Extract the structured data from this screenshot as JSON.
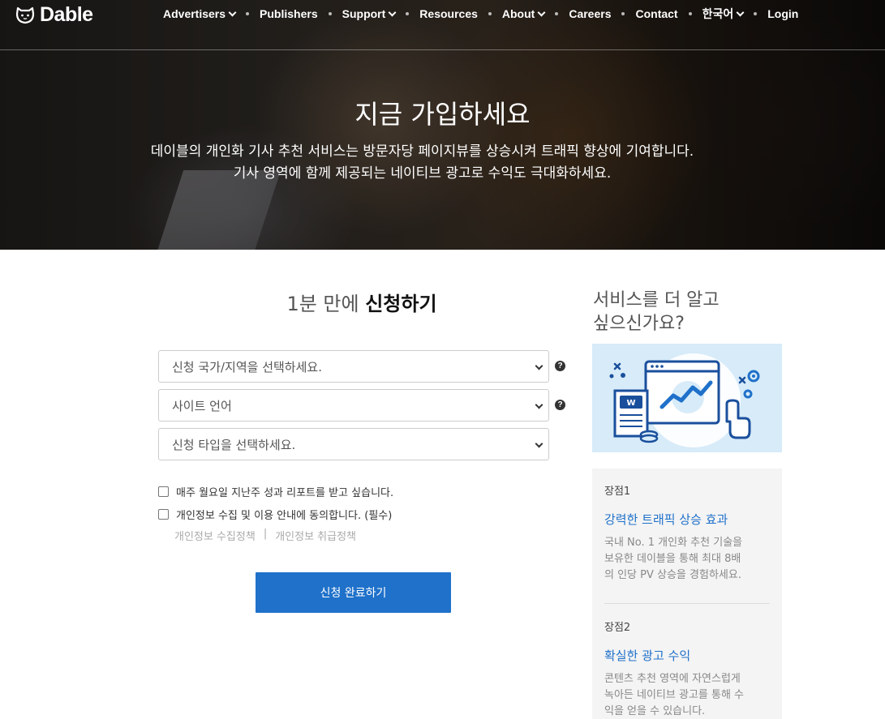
{
  "brand": {
    "name": "Dable"
  },
  "nav": {
    "items": [
      {
        "label": "Advertisers",
        "dropdown": true
      },
      {
        "label": "Publishers",
        "dropdown": false
      },
      {
        "label": "Support",
        "dropdown": true
      },
      {
        "label": "Resources",
        "dropdown": false
      },
      {
        "label": "About",
        "dropdown": true
      },
      {
        "label": "Careers",
        "dropdown": false
      },
      {
        "label": "Contact",
        "dropdown": false
      },
      {
        "label": "한국어",
        "dropdown": true
      },
      {
        "label": "Login",
        "dropdown": false
      }
    ]
  },
  "hero": {
    "title": "지금 가입하세요",
    "subtitle_line1": "데이블의 개인화 기사 추천 서비스는 방문자당 페이지뷰를 상승시켜 트래픽 향상에 기여합니다.",
    "subtitle_line2": "기사 영역에 함께 제공되는 네이티브 광고로 수익도 극대화하세요."
  },
  "form": {
    "title_prefix": "1분 만에 ",
    "title_bold": "신청하기",
    "country_select": "신청 국가/지역을 선택하세요.",
    "language_select": "사이트 언어",
    "type_select": "신청 타입을 선택하세요.",
    "help_glyph": "?",
    "weekly_report_label": "매주 월요일 지난주 성과 리포트를 받고 싶습니다.",
    "privacy_agree_label": "개인정보 수집 및 이용 안내에 동의합니다. (필수)",
    "privacy_collection_link": "개인정보 수집정책",
    "link_separator": "|",
    "privacy_handling_link": "개인정보 취급정책",
    "submit_label": "신청 완료하기"
  },
  "sidebar": {
    "title_line1": "서비스를 더 알고",
    "title_line2": "싶으신가요?",
    "illustration_badge": "W",
    "benefits": [
      {
        "label": "장점1",
        "title": "강력한 트래픽 상승 효과",
        "lines": [
          "국내 No. 1 개인화 추천 기술을",
          "보유한 데이블을 통해 최대 8배",
          "의 인당 PV 상승을 경험하세요."
        ]
      },
      {
        "label": "장점2",
        "title": "확실한 광고 수익",
        "lines": [
          "콘텐츠 추천 영역에 자연스럽게",
          "녹아든 네이티브 광고를 통해 수",
          "익을 얻을 수 있습니다."
        ]
      }
    ]
  },
  "colors": {
    "primary": "#1f71ca",
    "illustration_bg": "#d7ebf9"
  }
}
